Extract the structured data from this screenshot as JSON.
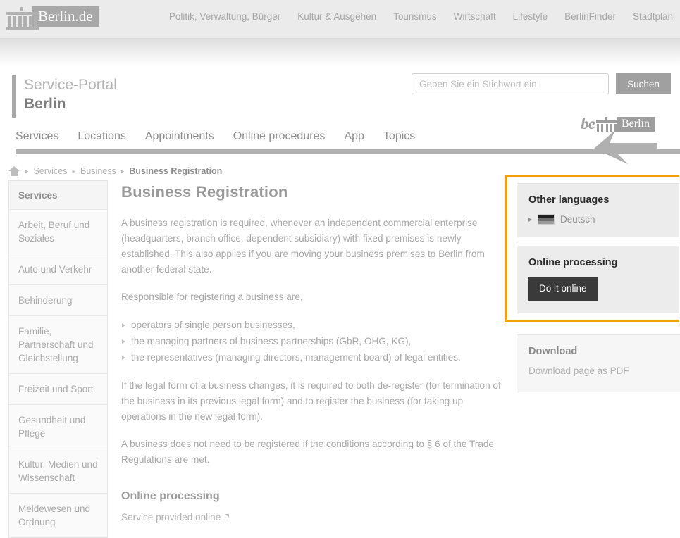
{
  "topbar": {
    "logo_text": "Berlin.de",
    "nav": [
      {
        "label": "Politik, Verwaltung, Bürger"
      },
      {
        "label": "Kultur & Ausgehen"
      },
      {
        "label": "Tourismus"
      },
      {
        "label": "Wirtschaft"
      },
      {
        "label": "Lifestyle"
      },
      {
        "label": "BerlinFinder"
      },
      {
        "label": "Stadtplan"
      }
    ]
  },
  "portal": {
    "title_line1": "Service-Portal",
    "title_line2": "Berlin",
    "search": {
      "value": "",
      "placeholder": "Geben Sie ein Stichwort ein",
      "button_label": "Suchen"
    }
  },
  "mainnav": {
    "items": [
      {
        "label": "Services"
      },
      {
        "label": "Locations"
      },
      {
        "label": "Appointments"
      },
      {
        "label": "Online procedures"
      },
      {
        "label": "App"
      },
      {
        "label": "Topics"
      }
    ],
    "brand_be": "be",
    "brand_berlin": "Berlin"
  },
  "breadcrumb": {
    "home_label": "Home",
    "items": [
      {
        "label": "Services",
        "current": false
      },
      {
        "label": "Business",
        "current": false
      },
      {
        "label": "Business Registration",
        "current": true
      }
    ],
    "separator": "▸"
  },
  "sidebar": {
    "heading": "Services",
    "items": [
      {
        "label": "Arbeit, Beruf und Soziales"
      },
      {
        "label": "Auto und Verkehr"
      },
      {
        "label": "Behinderung"
      },
      {
        "label": "Familie, Partnerschaft und Gleichstellung"
      },
      {
        "label": "Freizeit und Sport"
      },
      {
        "label": "Gesundheit und Pflege"
      },
      {
        "label": "Kultur, Medien und Wissenschaft"
      },
      {
        "label": "Meldewesen und Ordnung"
      }
    ]
  },
  "main": {
    "title": "Business Registration",
    "para1": "A business registration is required, whenever an independent commercial enterprise (headquarters, branch office, dependent subsidiary) with fixed premises is newly established. This also applies if you are moving your business premises to Berlin from another federal state.",
    "para2": "Responsible for registering a business are,",
    "bullets": [
      {
        "label": "operators of single person businesses,"
      },
      {
        "label": "the managing partners of business partnerships (GbR, OHG, KG),"
      },
      {
        "label": "the representatives (managing directors, management board) of legal entities."
      }
    ],
    "para3": "If the legal form of a business changes, it is required to both de-register (for termination of the business in its previous legal form) and to register the business (for taking up operations in the new legal form).",
    "para4": "A business does not need to be registered if the conditions according to § 6 of the Trade Regulations are met.",
    "section_title": "Online processing",
    "online_link": "Service provided online"
  },
  "right": {
    "languages": {
      "heading": "Other languages",
      "option": "Deutsch",
      "flag_colors": [
        "#1f1f1f",
        "#6e6e6e",
        "#9a9a9a"
      ]
    },
    "online": {
      "heading": "Online processing",
      "button_label": "Do it online"
    },
    "download": {
      "heading": "Download",
      "link": "Download page as PDF"
    },
    "highlight_color": "#f4a009"
  }
}
